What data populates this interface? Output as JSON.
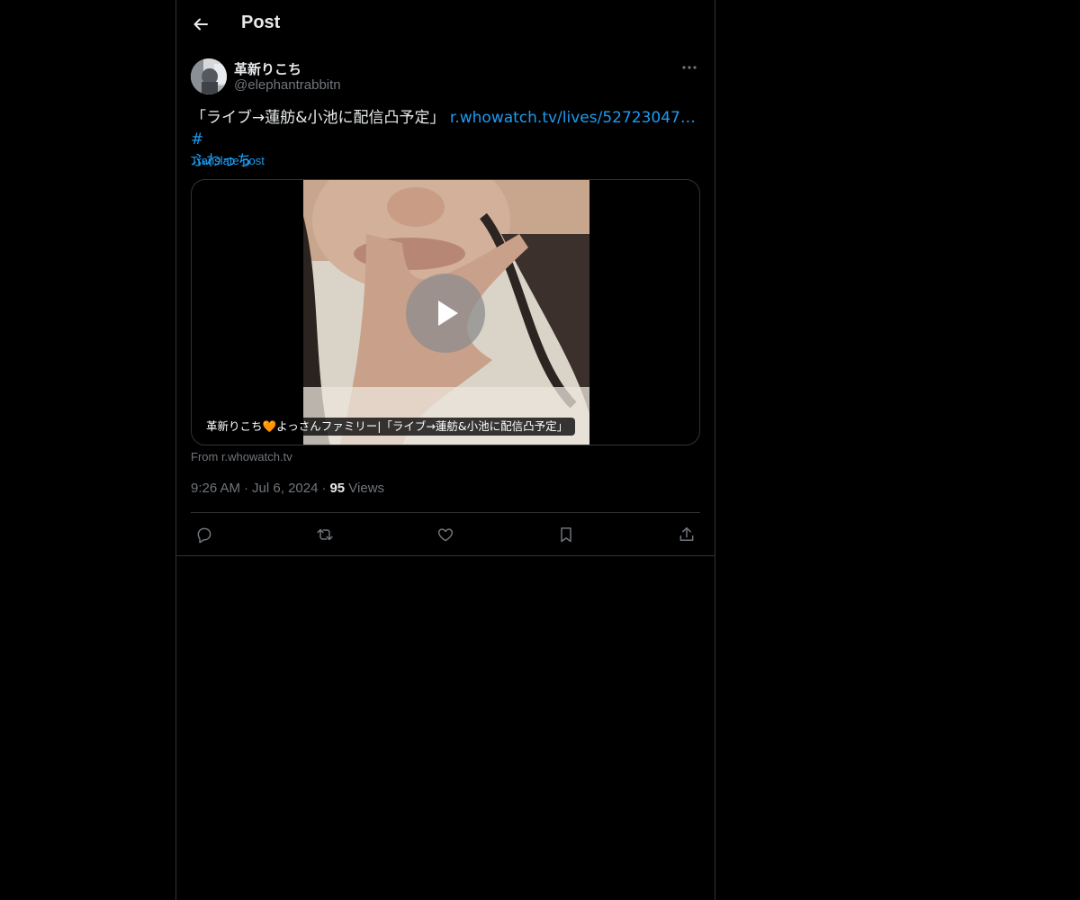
{
  "header": {
    "title": "Post"
  },
  "author": {
    "display_name": "革新りこち",
    "handle": "@elephantrabbitn"
  },
  "post": {
    "text": "「ライブ→蓮舫&小池に配信凸予定」 ",
    "link": "r.whowatch.tv/lives/52723047…",
    "hashtag_prefix": " #",
    "hashtag_line2": "ふわっち",
    "translate_label": "Translate post"
  },
  "media": {
    "caption": "革新りこち🧡よっさんファミリー|「ライブ→蓮舫&小池に配信凸予定」",
    "source": "From r.whowatch.tv"
  },
  "meta": {
    "time": "9:26 AM",
    "date": "Jul 6, 2024",
    "views_count": "95",
    "views_label": "Views",
    "separator": "·"
  },
  "actions": [
    {
      "icon": "reply-icon"
    },
    {
      "icon": "retweet-icon"
    },
    {
      "icon": "like-icon"
    },
    {
      "icon": "bookmark-icon"
    },
    {
      "icon": "share-icon"
    }
  ],
  "colors": {
    "accent": "#1d9bf0",
    "muted": "#71767b",
    "text": "#e7e9ea",
    "border": "#2f3336",
    "background": "#000000"
  }
}
